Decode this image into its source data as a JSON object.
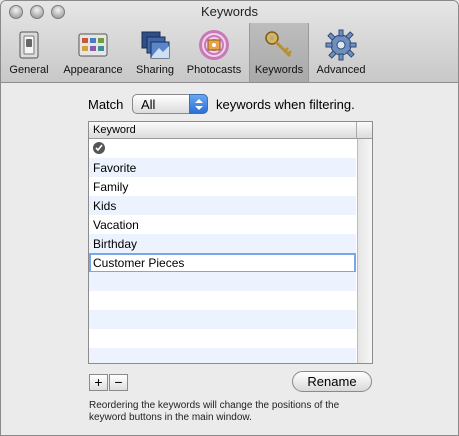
{
  "window": {
    "title": "Keywords"
  },
  "toolbar": {
    "items": [
      {
        "label": "General",
        "icon": "switch-icon",
        "active": false
      },
      {
        "label": "Appearance",
        "icon": "appearance-icon",
        "active": false
      },
      {
        "label": "Sharing",
        "icon": "sharing-icon",
        "active": false
      },
      {
        "label": "Photocasts",
        "icon": "photocasts-icon",
        "active": false
      },
      {
        "label": "Keywords",
        "icon": "key-icon",
        "active": true
      },
      {
        "label": "Advanced",
        "icon": "gear-icon",
        "active": false
      }
    ]
  },
  "match": {
    "label": "Match",
    "selected": "All",
    "suffix": "keywords when filtering."
  },
  "table": {
    "column_header": "Keyword",
    "rows": [
      {
        "label": "",
        "icon": "checkmark-icon"
      },
      {
        "label": "Favorite"
      },
      {
        "label": "Family"
      },
      {
        "label": "Kids"
      },
      {
        "label": "Vacation"
      },
      {
        "label": "Birthday"
      },
      {
        "label": "Customer Pieces",
        "editing": true
      }
    ]
  },
  "buttons": {
    "add": "+",
    "remove": "−",
    "rename": "Rename"
  },
  "note": "Reordering the keywords will change the positions of the keyword buttons in the main window.",
  "colors": {
    "accent": "#2b6fd6",
    "row_stripe": "#edf3fe",
    "edit_border": "#7aa6e8"
  }
}
